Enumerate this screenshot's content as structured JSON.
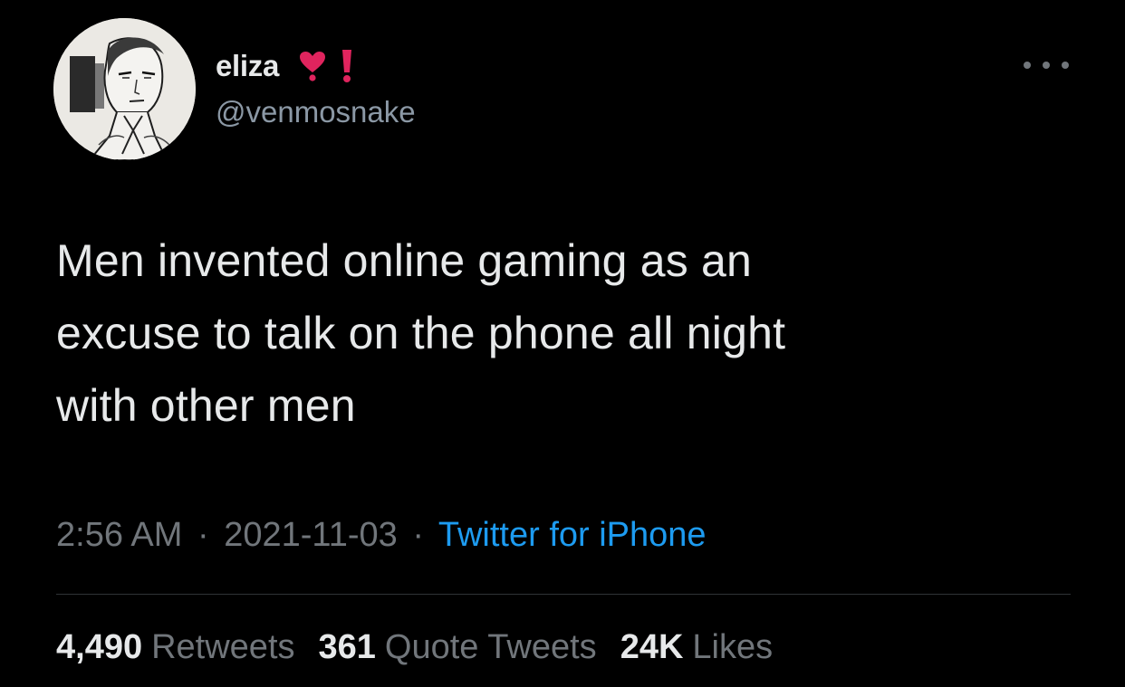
{
  "user": {
    "display_name": "eliza",
    "handle": "@venmosnake",
    "name_emojis": [
      "heavy-heart-exclamation-icon",
      "exclamation-mark-icon"
    ],
    "avatar": "sketch-portrait-avatar"
  },
  "menu": {
    "more_icon": "more-horizontal-icon"
  },
  "tweet": {
    "text_lines": [
      "Men invented online gaming as an",
      "excuse to talk on the phone all night",
      "with other men"
    ]
  },
  "meta": {
    "time": "2:56 AM",
    "separator": "·",
    "date": "2021-11-03",
    "source": "Twitter for iPhone"
  },
  "stats": {
    "retweets_count": "4,490",
    "retweets_label": "Retweets",
    "quotes_count": "361",
    "quotes_label": "Quote Tweets",
    "likes_count": "24K",
    "likes_label": "Likes"
  },
  "colors": {
    "background": "#000000",
    "primary_text": "#e7e9ea",
    "secondary_text": "#71767b",
    "link": "#1d9bf0",
    "divider": "#2f3336",
    "emoji_red": "#e0245e"
  }
}
